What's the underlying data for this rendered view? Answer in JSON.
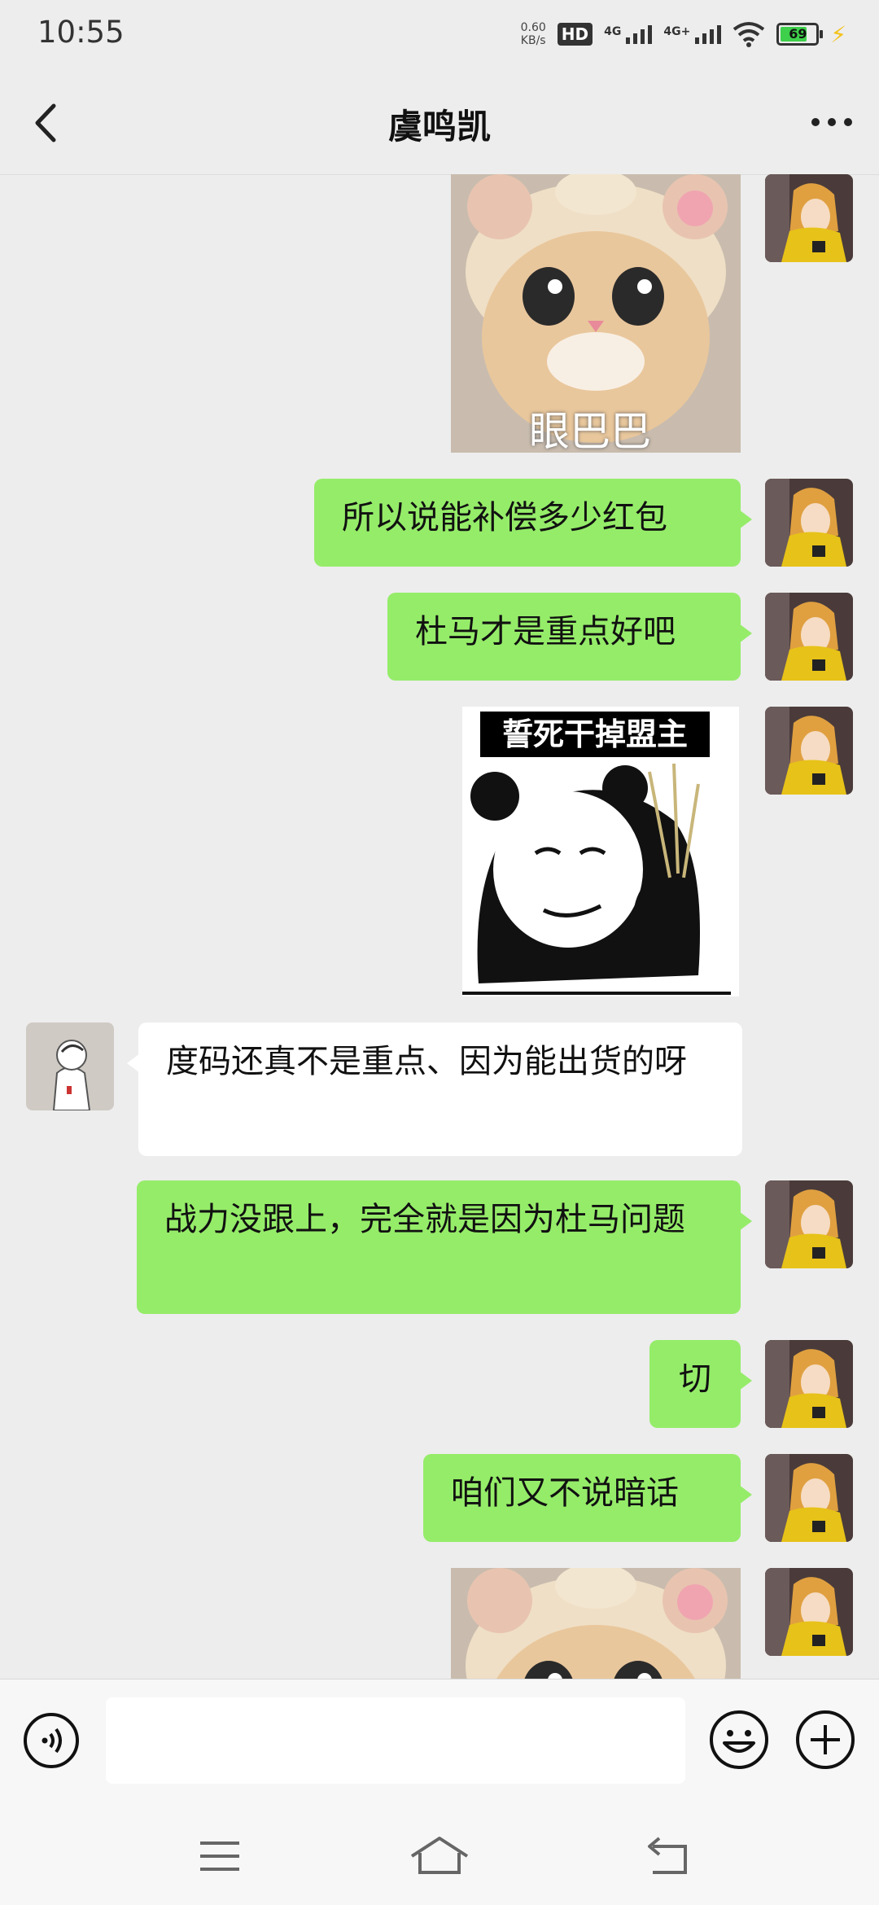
{
  "status_bar": {
    "time": "10:55",
    "net_speed_value": "0.60",
    "net_speed_unit": "KB/s",
    "hd_label": "HD",
    "sim1_label": "4G",
    "sim2_label": "4G+",
    "battery_level": "69"
  },
  "header": {
    "title": "虞鸣凯",
    "back_icon": "chevron-left-icon",
    "more_icon": "more-dots-icon"
  },
  "messages": [
    {
      "side": "right",
      "type": "sticker",
      "sticker_caption": "眼巴巴"
    },
    {
      "side": "right",
      "type": "text",
      "text": "所以说能补偿多少红包"
    },
    {
      "side": "right",
      "type": "text",
      "text": "杜马才是重点好吧"
    },
    {
      "side": "right",
      "type": "sticker",
      "sticker_caption": "誓死干掉盟主"
    },
    {
      "side": "left",
      "type": "text",
      "text": "度码还真不是重点、因为能出货的呀"
    },
    {
      "side": "right",
      "type": "text",
      "text": "战力没跟上，完全就是因为杜马问题"
    },
    {
      "side": "right",
      "type": "text",
      "text": "切"
    },
    {
      "side": "right",
      "type": "text",
      "text": "咱们又不说暗话"
    },
    {
      "side": "right",
      "type": "sticker",
      "sticker_caption": ""
    }
  ],
  "input_bar": {
    "voice_icon": "voice-input-icon",
    "placeholder": "",
    "emoji_icon": "emoji-icon",
    "plus_icon": "plus-icon"
  },
  "nav_bar": {
    "menu_icon": "menu-icon",
    "home_icon": "home-icon",
    "back_icon": "back-icon"
  },
  "colors": {
    "outgoing_bubble": "#95ec69",
    "incoming_bubble": "#ffffff",
    "background": "#ededed"
  }
}
